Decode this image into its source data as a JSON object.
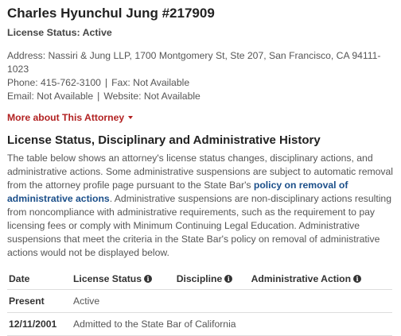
{
  "attorney": {
    "name": "Charles Hyunchul Jung #217909",
    "license_status": "License Status: Active"
  },
  "contact": {
    "address": "Address: Nassiri & Jung LLP, 1700 Montgomery St, Ste 207, San Francisco, CA 94111-1023",
    "phone": "Phone: 415-762-3100",
    "fax": "Fax: Not Available",
    "email": "Email: Not Available",
    "website": "Website: Not Available",
    "separator": "|"
  },
  "more_link": "More about This Attorney",
  "history": {
    "title": "License Status, Disciplinary and Administrative History",
    "para_before_link": "The table below shows an attorney's license status changes, disciplinary actions, and administrative actions. Some administrative suspensions are subject to automatic removal from the attorney profile page pursuant to the State Bar's ",
    "link_text": "policy on removal of administrative actions",
    "para_after_link": ". Administrative suspensions are non-disciplinary actions resulting from noncompliance with administrative requirements, such as the requirement to pay licensing fees or comply with Minimum Continuing Legal Education. Administrative suspensions that meet the criteria in the State Bar's policy on removal of administrative actions would not be displayed below."
  },
  "table": {
    "headers": [
      "Date",
      "License Status",
      "Discipline",
      "Administrative Action"
    ],
    "info_icon": "info-circle-icon",
    "rows": [
      {
        "date": "Present",
        "status": "Active",
        "discipline": "",
        "admin": ""
      },
      {
        "date": "12/11/2001",
        "status": "Admitted to the State Bar of California",
        "discipline": "",
        "admin": ""
      }
    ]
  },
  "colors": {
    "link_red": "#b22222",
    "link_blue": "#1b4f8a",
    "text": "#555555"
  }
}
